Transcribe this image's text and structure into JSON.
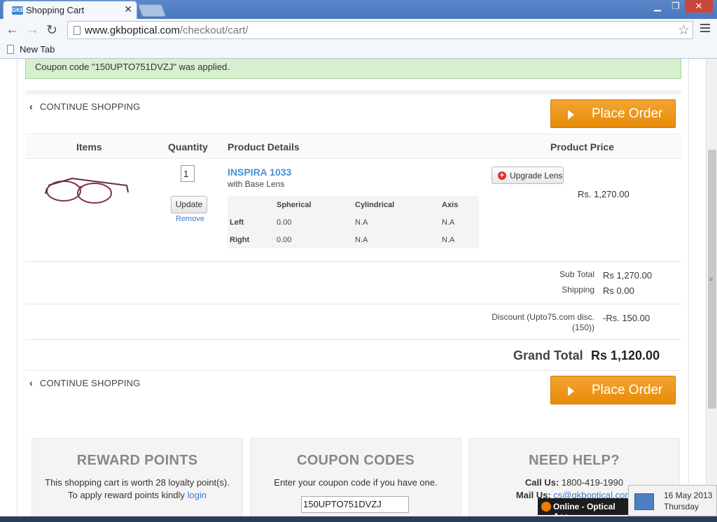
{
  "browser": {
    "tab_title": "Shopping Cart",
    "tab_favicon_text": "GKB",
    "url_host": "www.gkboptical.com",
    "url_path": "/checkout/cart/",
    "bookmark": "New Tab"
  },
  "page": {
    "coupon_message": "Coupon code \"150UPTO751DVZJ\" was applied.",
    "continue_label": "CONTINUE SHOPPING",
    "place_order_label": "Place Order",
    "table_headers": {
      "items": "Items",
      "quantity": "Quantity",
      "details": "Product Details",
      "price": "Product Price"
    },
    "item": {
      "quantity": "1",
      "update_label": "Update",
      "remove_label": "Remove",
      "name": "INSPIRA 1033",
      "subtitle": "with Base Lens",
      "upgrade_label": "Upgrade Lens",
      "price": "Rs. 1,270.00",
      "lens_table": {
        "headers": [
          "Spherical",
          "Cylindrical",
          "Axis"
        ],
        "rows": [
          {
            "label": "Left",
            "values": [
              "0.00",
              "N.A",
              "N.A"
            ]
          },
          {
            "label": "Right",
            "values": [
              "0.00",
              "N.A",
              "N.A"
            ]
          }
        ]
      }
    },
    "summary": {
      "subtotal_label": "Sub Total",
      "subtotal_value": "Rs 1,270.00",
      "shipping_label": "Shipping",
      "shipping_value": "Rs 0.00",
      "discount_label_1": "Discount (Upto75.com disc.",
      "discount_label_2": "(150))",
      "discount_value": "-Rs. 150.00",
      "grand_total_label": "Grand Total",
      "grand_total_value": "Rs 1,120.00"
    },
    "reward": {
      "title": "REWARD POINTS",
      "line1": "This shopping cart is worth 28 loyalty point(s).",
      "line2": "To apply reward points kindly",
      "link": "login"
    },
    "coupon": {
      "title": "COUPON CODES",
      "text": "Enter your coupon code if you have one.",
      "value": "150UPTO751DVZJ"
    },
    "help": {
      "title": "NEED HELP?",
      "call_label": "Call Us:",
      "call_value": "1800-419-1990",
      "mail_label": "Mail Us:",
      "mail_value": "cs@gkboptical.com"
    }
  },
  "overlay": {
    "chat_status": "Online - Optical Ass",
    "date": "16 May 2013",
    "day": "Thursday"
  }
}
